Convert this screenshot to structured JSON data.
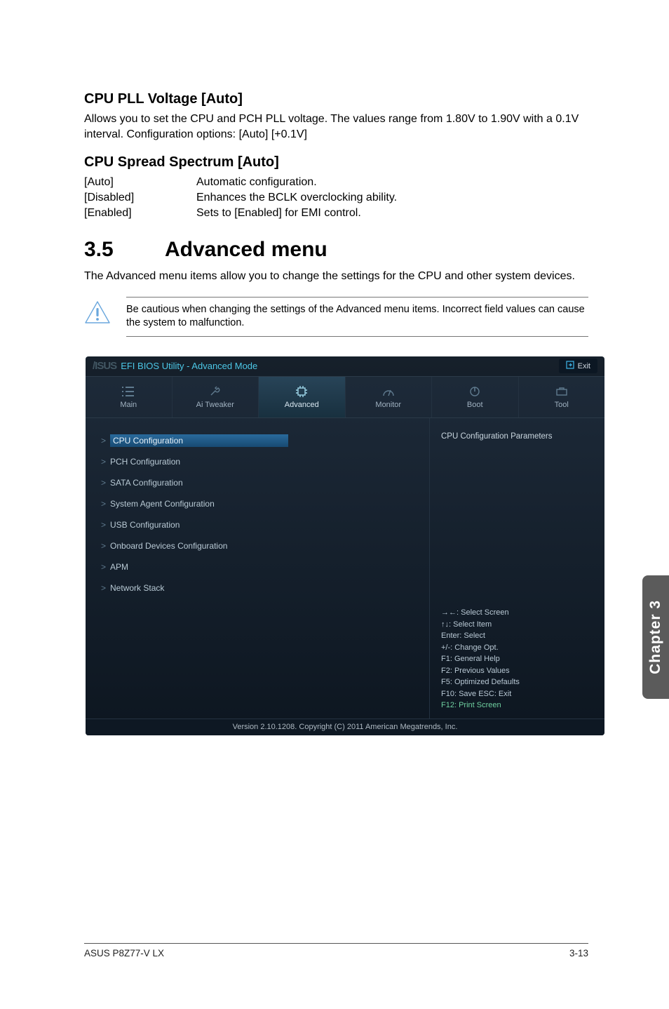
{
  "sections": {
    "cpu_pll": {
      "title": "CPU PLL Voltage [Auto]",
      "desc": "Allows you to set the CPU and PCH PLL voltage. The values range from 1.80V to 1.90V with a 0.1V interval. Configuration options: [Auto] [+0.1V]"
    },
    "spread": {
      "title": "CPU Spread Spectrum [Auto]",
      "opts": [
        {
          "k": "[Auto]",
          "v": "Automatic configuration."
        },
        {
          "k": "[Disabled]",
          "v": "Enhances the BCLK overclocking ability."
        },
        {
          "k": "[Enabled]",
          "v": "Sets to [Enabled] for EMI control."
        }
      ]
    },
    "advanced": {
      "num": "3.5",
      "title": "Advanced menu",
      "desc": "The Advanced menu items allow you to change the settings for the CPU and other system devices.",
      "note": "Be cautious when changing the settings of the Advanced menu items. Incorrect field values can cause the system to malfunction."
    }
  },
  "bios": {
    "brand": "/ISUS",
    "title": "EFI BIOS Utility - Advanced Mode",
    "exit": "Exit",
    "tabs": [
      {
        "label": "Main"
      },
      {
        "label": "Ai Tweaker"
      },
      {
        "label": "Advanced",
        "active": true
      },
      {
        "label": "Monitor"
      },
      {
        "label": "Boot"
      },
      {
        "label": "Tool"
      }
    ],
    "menu": [
      {
        "label": "CPU Configuration",
        "selected": true
      },
      {
        "label": "PCH Configuration"
      },
      {
        "label": "SATA Configuration"
      },
      {
        "label": "System Agent Configuration"
      },
      {
        "label": "USB Configuration"
      },
      {
        "label": "Onboard Devices Configuration"
      },
      {
        "label": "APM"
      },
      {
        "label": "Network Stack"
      }
    ],
    "help_title": "CPU Configuration Parameters",
    "hints": [
      "→←: Select Screen",
      "↑↓: Select Item",
      "Enter: Select",
      "+/-: Change Opt.",
      "F1: General Help",
      "F2: Previous Values",
      "F5: Optimized Defaults",
      "F10: Save   ESC: Exit",
      "F12: Print Screen"
    ],
    "footer": "Version 2.10.1208. Copyright (C) 2011 American Megatrends, Inc."
  },
  "side_tab": "Chapter 3",
  "page_footer": {
    "left": "ASUS P8Z77-V LX",
    "right": "3-13"
  }
}
